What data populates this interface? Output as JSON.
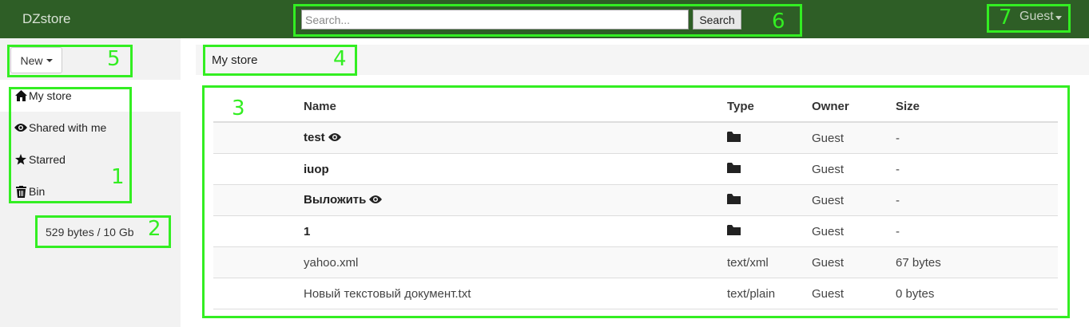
{
  "header": {
    "brand": "DZstore",
    "search_placeholder": "Search...",
    "search_button": "Search",
    "user": "Guest"
  },
  "toolbar": {
    "new_label": "New"
  },
  "sidebar": {
    "items": [
      {
        "label": "My store",
        "icon": "home-icon",
        "active": true
      },
      {
        "label": "Shared with me",
        "icon": "eye-icon"
      },
      {
        "label": "Starred",
        "icon": "star-icon"
      },
      {
        "label": "Bin",
        "icon": "trash-icon"
      }
    ],
    "quota": "529 bytes / 10 Gb"
  },
  "breadcrumb": "My store",
  "table": {
    "headers": {
      "name": "Name",
      "type": "Type",
      "owner": "Owner",
      "size": "Size"
    },
    "rows": [
      {
        "name": "test",
        "folder": true,
        "shared": true,
        "type_icon": "folder-icon",
        "owner": "Guest",
        "size": "-"
      },
      {
        "name": "iuop",
        "folder": true,
        "shared": false,
        "type_icon": "folder-icon",
        "owner": "Guest",
        "size": "-"
      },
      {
        "name": "Выложить",
        "folder": true,
        "shared": true,
        "type_icon": "folder-icon",
        "owner": "Guest",
        "size": "-"
      },
      {
        "name": "1",
        "folder": true,
        "shared": false,
        "type_icon": "folder-icon",
        "owner": "Guest",
        "size": "-"
      },
      {
        "name": "yahoo.xml",
        "folder": false,
        "shared": false,
        "type": "text/xml",
        "owner": "Guest",
        "size": "67 bytes"
      },
      {
        "name": "Новый текстовый документ.txt",
        "folder": false,
        "shared": false,
        "type": "text/plain",
        "owner": "Guest",
        "size": "0 bytes"
      }
    ]
  },
  "annotations": [
    "1",
    "2",
    "3",
    "4",
    "5",
    "6",
    "7"
  ],
  "colors": {
    "navbar": "#2e5e26",
    "annotation": "#33ee22"
  }
}
